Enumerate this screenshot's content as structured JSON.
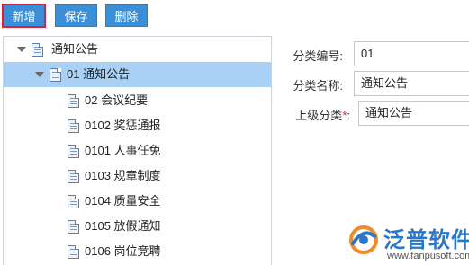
{
  "toolbar": {
    "new_label": "新增",
    "save_label": "保存",
    "delete_label": "删除"
  },
  "tree": {
    "root": {
      "label": "通知公告",
      "expanded": true
    },
    "selected": {
      "label": "01 通知公告",
      "expanded": true
    },
    "children": [
      {
        "label": "02 会议纪要"
      },
      {
        "label": "0102 奖惩通报"
      },
      {
        "label": "0101 人事任免"
      },
      {
        "label": "0103 规章制度"
      },
      {
        "label": "0104 质量安全"
      },
      {
        "label": "0105 放假通知"
      },
      {
        "label": "0106 岗位竞聘"
      }
    ]
  },
  "form": {
    "code_label": "分类编号:",
    "code_value": "01",
    "name_label": "分类名称:",
    "name_value": "通知公告",
    "parent_label": "上级分类",
    "parent_required_mark": "*",
    "parent_colon": ":",
    "parent_value": "通知公告"
  },
  "logo": {
    "name": "泛普软件",
    "url": "www.fanpusoft.com"
  },
  "colors": {
    "button_blue": "#3b8fd6",
    "selection_blue": "#a9d1f5",
    "highlight_red": "#e0202f",
    "logo_blue": "#2a77c9"
  }
}
